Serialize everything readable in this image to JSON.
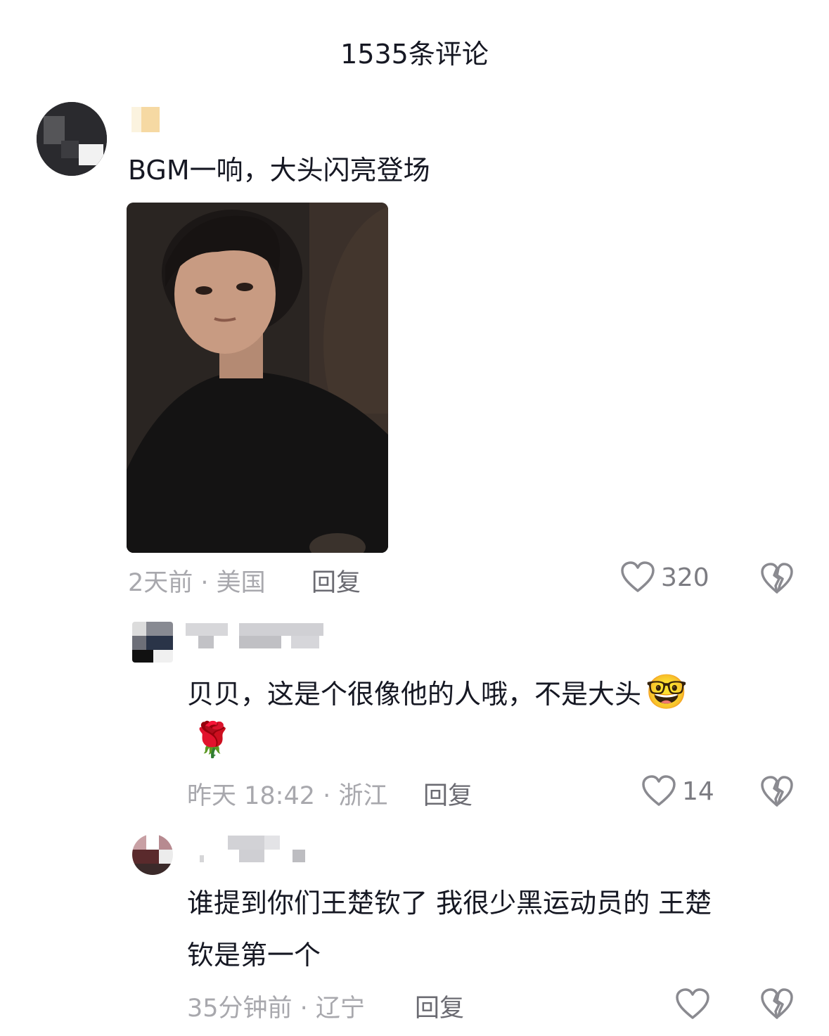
{
  "header": {
    "title": "1535条评论"
  },
  "comments": [
    {
      "text": "BGM一响，大头闪亮登场",
      "time_location": "2天前 · 美国",
      "reply_label": "回复",
      "likes": "320"
    },
    {
      "text_line1": "贝贝，这是个很像他的人哦，不是大头",
      "emoji1": "🤓",
      "emoji2": "🌹",
      "time_location": "昨天 18:42 · 浙江",
      "reply_label": "回复",
      "likes": "14"
    },
    {
      "text_line1": "谁提到你们王楚钦了 我很少黑运动员的 王楚",
      "text_line2": "钦是第一个",
      "time_location": "35分钟前 · 辽宁",
      "reply_label": "回复"
    }
  ],
  "icons": {
    "like": "heart-outline-icon",
    "dislike": "broken-heart-icon"
  }
}
